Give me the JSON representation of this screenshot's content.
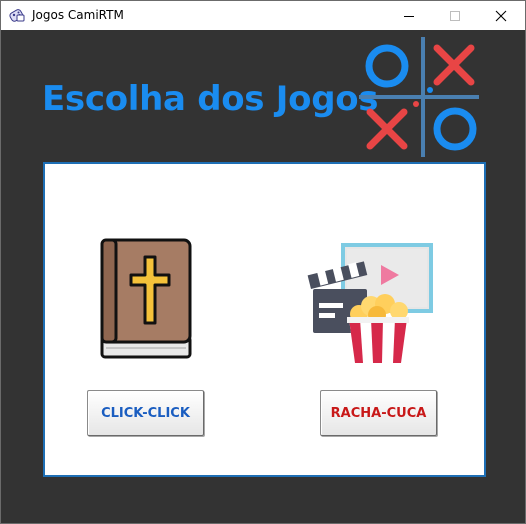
{
  "window": {
    "title": "Jogos CamiRTM",
    "app_icon": "game-app-icon",
    "controls": {
      "minimize_icon": "minimize-icon",
      "maximize_icon": "maximize-icon",
      "close_icon": "close-icon"
    }
  },
  "header": {
    "title": "Escolha dos Jogos",
    "logo_icon": "tic-tac-toe-icon",
    "title_color": "#1a8cf0"
  },
  "games": [
    {
      "icon": "bible-icon",
      "button_label": "CLICK-CLICK",
      "button_color": "#1a5dc0"
    },
    {
      "icon": "movie-popcorn-icon",
      "button_label": "RACHA-CUCA",
      "button_color": "#c81818"
    }
  ],
  "colors": {
    "background": "#333333",
    "panel_border": "#1e6fb5",
    "ttt_blue": "#1a8cf0",
    "ttt_red": "#e84545",
    "ttt_grid": "#4a7fb0"
  }
}
